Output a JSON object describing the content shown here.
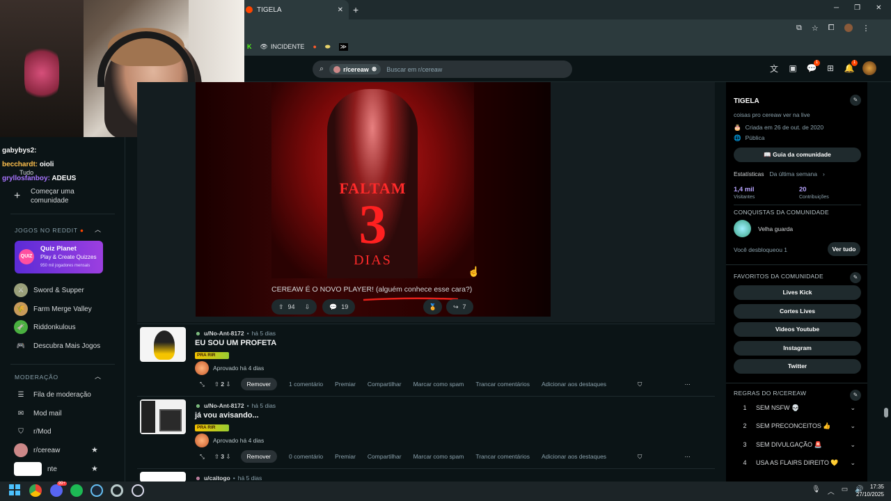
{
  "browser": {
    "tab_title": "TIGELA",
    "new_tab": "+",
    "bookmarks": [
      "INCIDENTE"
    ]
  },
  "header": {
    "search_chip": "r/cereaw",
    "search_placeholder": "Buscar em r/cereaw",
    "chat_badge": "1",
    "notif_badge": "1"
  },
  "chat_overlay": [
    {
      "user": "gabybys2:",
      "msg": "",
      "color": "#f5f5f5"
    },
    {
      "user": "becchardt:",
      "msg": "oioli",
      "color": "#ffc04d"
    },
    {
      "user": "gryllosfanboy:",
      "msg": "ADEUS",
      "color": "#a874ff"
    }
  ],
  "left_sidebar": {
    "tudo": "Tudo",
    "create_community": "Começar uma comunidade",
    "games_header": "JOGOS NO REDDIT",
    "quiz": {
      "title": "Quiz Planet",
      "subtitle": "Play & Create Quizzes",
      "players": "950 mil jogadores mensais",
      "logo": "QUIZ"
    },
    "games": [
      "Sword & Supper",
      "Farm Merge Valley",
      "Riddonkulous"
    ],
    "discover": "Descubra Mais Jogos",
    "mod_header": "MODERAÇÃO",
    "mod_items": [
      "Fila de moderação",
      "Mod mail",
      "r/Mod",
      "r/cereaw",
      "nte"
    ]
  },
  "main_post": {
    "poster_line1": "FALTAM",
    "poster_line2": "3",
    "poster_line3": "DIAS",
    "caption_plain": "CEREAW É O NOVO PLAYER!",
    "caption_underlined": "(alguém conhece esse cara?)",
    "upvotes": "94",
    "comments": "19",
    "shares": "7"
  },
  "list_posts": [
    {
      "author": "u/No-Ant-8172",
      "age": "há 5 dias",
      "title": "EU SOU UM PROFETA",
      "flair": "PRA RIR",
      "approved": "Aprovado há 4 dias",
      "votes": "2",
      "actions": [
        "Remover",
        "1 comentário",
        "Premiar",
        "Compartilhar",
        "Marcar como spam",
        "Trancar comentários",
        "Adicionar aos destaques"
      ]
    },
    {
      "author": "u/No-Ant-8172",
      "age": "há 5 dias",
      "title": "já vou avisando...",
      "flair": "PRA RIR",
      "approved": "Aprovado há 4 dias",
      "votes": "3",
      "actions": [
        "Remover",
        "0 comentário",
        "Premiar",
        "Compartilhar",
        "Marcar como spam",
        "Trancar comentários",
        "Adicionar aos destaques"
      ]
    },
    {
      "author": "u/caitogo",
      "age": "há 5 dias"
    }
  ],
  "right_sidebar": {
    "name": "TIGELA",
    "description": "coisas pro cereaw ver na live",
    "created": "Criada em 26 de out. de 2020",
    "visibility": "Pública",
    "guide_button": "Guia da comunidade",
    "stats_label": "Estatísticas",
    "stats_period": "Da última semana",
    "visitors_value": "1,4 mil",
    "visitors_label": "Visitantes",
    "contrib_value": "20",
    "contrib_label": "Contribuições",
    "achievements_header": "CONQUISTAS DA COMUNIDADE",
    "achievement_name": "Velha guarda",
    "unlocked_text": "Você desbloqueou 1",
    "see_all": "Ver tudo",
    "favorites_header": "FAVORITOS DA COMUNIDADE",
    "favorites": [
      "Lives Kick",
      "Cortes Lives",
      "Videos Youtube",
      "Instagram",
      "Twitter"
    ],
    "rules_header": "REGRAS DO R/CEREAW",
    "rules": [
      {
        "n": "1",
        "text": "SEM NSFW 💀"
      },
      {
        "n": "2",
        "text": "SEM PRECONCEITOS 👍"
      },
      {
        "n": "3",
        "text": "SEM DIVULGAÇÃO 🚨"
      },
      {
        "n": "4",
        "text": "USA AS FLAIRS DIREITO 💛"
      }
    ]
  },
  "taskbar": {
    "time": "17:35",
    "date": "27/10/2025",
    "discord_badge": "99+"
  },
  "colors": {
    "accent": "#ff4500",
    "bg": "#0b1416",
    "card": "#141d20"
  }
}
